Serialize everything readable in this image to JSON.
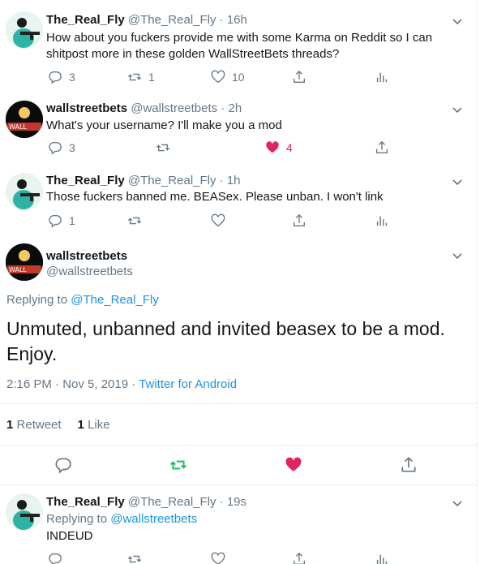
{
  "tweets": [
    {
      "name": "The_Real_Fly",
      "meta": "@The_Real_Fly · 16h",
      "text_lines": [
        "How about you fuckers provide me with some Karma on Reddit so I can",
        "shitpost more in these golden WallStreetBets threads?"
      ],
      "reply_count": "3",
      "retweet_count": "1",
      "like_count": "10"
    },
    {
      "name": "wallstreetbets",
      "meta": "@wallstreetbets · 2h",
      "text_lines": [
        "What's your username? I'll make you a mod"
      ],
      "reply_count": "3",
      "retweet_count": "",
      "like_count": "4"
    },
    {
      "name": "The_Real_Fly",
      "meta": "@The_Real_Fly · 1h",
      "text_lines": [
        "Those fuckers banned me. BEASex. Please unban. I won't link"
      ],
      "reply_count": "1",
      "retweet_count": "",
      "like_count": ""
    }
  ],
  "main_tweet": {
    "name": "wallstreetbets",
    "handle": "@wallstreetbets",
    "replying_prefix": "Replying to",
    "replying_to": "@The_Real_Fly",
    "text": "Unmuted, unbanned and invited beasex to be a mod. Enjoy.",
    "time": "2:16 PM · Nov 5, 2019 ·",
    "source": "Twitter for Android",
    "retweet_count": "1",
    "retweet_label": "Retweet",
    "like_count": "1",
    "like_label": "Like"
  },
  "last_tweet": {
    "name": "The_Real_Fly",
    "meta": "@The_Real_Fly · 19s",
    "replying_prefix": "Replying to",
    "replying_to": "@wallstreetbets",
    "text": "INDEUD"
  },
  "avatar_texts": {
    "wsb": "WALL"
  },
  "colors": {
    "accent_blue": "#1b95e0",
    "like_red": "#e0245e",
    "retweet_green": "#17bf63",
    "muted_gray": "#657786",
    "divider": "#e6ecf0"
  },
  "icons": [
    "chevron-down-icon",
    "reply-icon",
    "retweet-icon",
    "like-icon",
    "share-icon",
    "analytics-icon"
  ]
}
